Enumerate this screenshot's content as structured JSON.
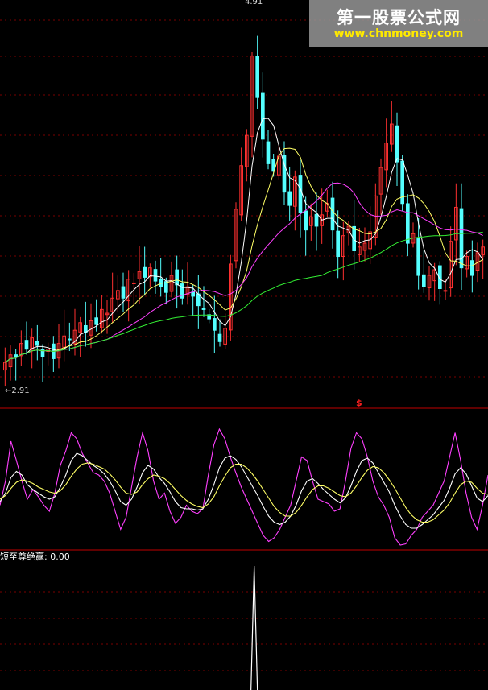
{
  "watermark": {
    "title": "第一股票公式网",
    "url": "www.chnmoney.com"
  },
  "price_panel": {
    "high_label": "4.91",
    "low_label": "2.91",
    "signal_marker": "$"
  },
  "indicator_panel": {
    "label": "短至尊绝赢",
    "value": "0.00"
  },
  "colors": {
    "background": "#000000",
    "up_candle": "#ff3030",
    "down_candle": "#54ffff",
    "ma_fast": "#ffffff",
    "ma_mid": "#ffff66",
    "ma_slow": "#ff40ff",
    "ma_long": "#33ee33",
    "grid": "#7a0000",
    "divider": "#c00000"
  },
  "chart_data": [
    {
      "type": "candlestick",
      "panel": "price",
      "ylim": [
        2.91,
        4.91
      ],
      "high_label": "4.91",
      "low_label": "2.91",
      "close": [
        3.02,
        3.06,
        3.05,
        3.12,
        3.09,
        3.15,
        3.11,
        3.05,
        3.09,
        3.04,
        3.12,
        3.16,
        3.14,
        3.19,
        3.23,
        3.18,
        3.24,
        3.22,
        3.3,
        3.28,
        3.36,
        3.4,
        3.36,
        3.46,
        3.44,
        3.5,
        3.47,
        3.52,
        3.45,
        3.42,
        3.39,
        3.48,
        3.43,
        3.36,
        3.42,
        3.37,
        3.32,
        3.3,
        3.25,
        3.19,
        3.13,
        3.2,
        3.54,
        3.83,
        4.06,
        4.22,
        4.64,
        4.42,
        4.2,
        4.07,
        4.03,
        4.11,
        3.92,
        3.85,
        4.0,
        3.81,
        3.72,
        3.79,
        3.74,
        3.8,
        3.86,
        3.72,
        3.58,
        3.69,
        3.74,
        3.61,
        3.63,
        3.65,
        3.71,
        3.9,
        4.05,
        4.18,
        4.28,
        4.08,
        3.86,
        3.65,
        3.7,
        3.48,
        3.42,
        3.48,
        3.51,
        3.41,
        3.4,
        3.66,
        3.84,
        3.52,
        3.58,
        3.48,
        3.6,
        3.63
      ],
      "volatility_note": "",
      "ma_periods": [
        5,
        10,
        20,
        60
      ]
    },
    {
      "type": "line",
      "panel": "oscillator",
      "series": [
        {
          "color": "#ff40ff",
          "values": [
            0.35,
            0.55,
            0.88,
            0.72,
            0.55,
            0.4,
            0.48,
            0.42,
            0.35,
            0.3,
            0.45,
            0.68,
            0.8,
            0.95,
            0.9,
            0.78,
            0.7,
            0.62,
            0.6,
            0.55,
            0.45,
            0.3,
            0.15,
            0.25,
            0.5,
            0.75,
            0.95,
            0.8,
            0.55,
            0.4,
            0.45,
            0.3,
            0.2,
            0.25,
            0.35,
            0.3,
            0.28,
            0.32,
            0.6,
            0.85,
            0.98,
            0.9,
            0.75,
            0.62,
            0.5,
            0.4,
            0.3,
            0.2,
            0.1,
            0.05,
            0.08,
            0.15,
            0.25,
            0.35,
            0.55,
            0.75,
            0.72,
            0.55,
            0.4,
            0.38,
            0.36,
            0.3,
            0.32,
            0.55,
            0.82,
            0.95,
            0.9,
            0.75,
            0.55,
            0.42,
            0.35,
            0.25,
            0.08,
            0.02,
            0.03,
            0.1,
            0.15,
            0.25,
            0.3,
            0.35,
            0.45,
            0.55,
            0.75,
            0.95,
            0.72,
            0.45,
            0.25,
            0.15,
            0.35,
            0.6
          ]
        },
        {
          "color": "#ffffff",
          "values": [
            0.38,
            0.45,
            0.58,
            0.63,
            0.6,
            0.52,
            0.48,
            0.45,
            0.42,
            0.4,
            0.42,
            0.5,
            0.6,
            0.72,
            0.78,
            0.76,
            0.72,
            0.68,
            0.65,
            0.61,
            0.55,
            0.47,
            0.38,
            0.35,
            0.4,
            0.5,
            0.62,
            0.68,
            0.65,
            0.58,
            0.53,
            0.46,
            0.38,
            0.33,
            0.32,
            0.32,
            0.31,
            0.32,
            0.4,
            0.52,
            0.66,
            0.74,
            0.76,
            0.73,
            0.67,
            0.59,
            0.51,
            0.43,
            0.34,
            0.26,
            0.21,
            0.19,
            0.21,
            0.26,
            0.35,
            0.47,
            0.55,
            0.57,
            0.53,
            0.48,
            0.44,
            0.4,
            0.37,
            0.41,
            0.51,
            0.63,
            0.72,
            0.74,
            0.7,
            0.62,
            0.54,
            0.46,
            0.35,
            0.26,
            0.19,
            0.16,
            0.16,
            0.19,
            0.23,
            0.27,
            0.33,
            0.39,
            0.49,
            0.61,
            0.66,
            0.61,
            0.51,
            0.41,
            0.38,
            0.43
          ]
        },
        {
          "color": "#ffff66",
          "values": [
            0.4,
            0.43,
            0.49,
            0.54,
            0.56,
            0.55,
            0.53,
            0.5,
            0.48,
            0.46,
            0.45,
            0.47,
            0.52,
            0.59,
            0.65,
            0.69,
            0.7,
            0.69,
            0.67,
            0.65,
            0.61,
            0.56,
            0.5,
            0.45,
            0.44,
            0.46,
            0.52,
            0.57,
            0.6,
            0.59,
            0.57,
            0.53,
            0.48,
            0.43,
            0.39,
            0.36,
            0.34,
            0.33,
            0.36,
            0.42,
            0.51,
            0.59,
            0.66,
            0.69,
            0.69,
            0.66,
            0.61,
            0.55,
            0.48,
            0.41,
            0.34,
            0.29,
            0.26,
            0.26,
            0.29,
            0.35,
            0.42,
            0.48,
            0.51,
            0.51,
            0.49,
            0.46,
            0.43,
            0.42,
            0.45,
            0.51,
            0.58,
            0.64,
            0.67,
            0.66,
            0.62,
            0.56,
            0.49,
            0.41,
            0.33,
            0.27,
            0.23,
            0.21,
            0.21,
            0.23,
            0.27,
            0.31,
            0.37,
            0.45,
            0.52,
            0.55,
            0.54,
            0.49,
            0.45,
            0.44
          ]
        }
      ]
    },
    {
      "type": "line",
      "panel": "indicator",
      "label": "短至尊绝赢",
      "current_value": 0.0,
      "spike_index": 47,
      "values": [
        0,
        0,
        0,
        0,
        0,
        0,
        0,
        0,
        0,
        0,
        0,
        0,
        0,
        0,
        0,
        0,
        0,
        0,
        0,
        0,
        0,
        0,
        0,
        0,
        0,
        0,
        0,
        0,
        0,
        0,
        0,
        0,
        0,
        0,
        0,
        0,
        0,
        0,
        0,
        0,
        0,
        0,
        0,
        0,
        0,
        0,
        0,
        1,
        0,
        0,
        0,
        0,
        0,
        0,
        0,
        0,
        0,
        0,
        0,
        0,
        0,
        0,
        0,
        0,
        0,
        0,
        0,
        0,
        0,
        0,
        0,
        0,
        0,
        0,
        0,
        0,
        0,
        0,
        0,
        0,
        0,
        0,
        0,
        0,
        0,
        0,
        0,
        0,
        0,
        0
      ]
    }
  ]
}
